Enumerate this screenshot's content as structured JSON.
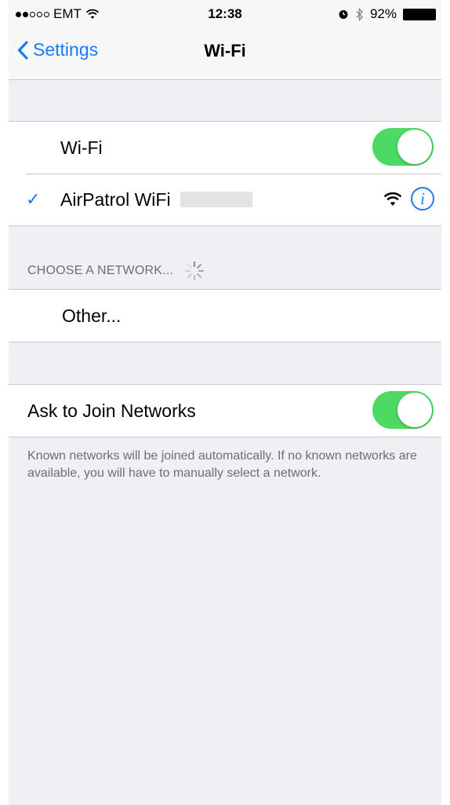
{
  "status_bar": {
    "carrier": "EMT",
    "time": "12:38",
    "battery_percent": "92%",
    "signal_strength": 2,
    "signal_total": 5
  },
  "nav": {
    "back_label": "Settings",
    "title": "Wi-Fi"
  },
  "wifi": {
    "toggle_label": "Wi-Fi",
    "enabled": true,
    "connected_network": "AirPatrol WiFi",
    "info_glyph": "i"
  },
  "choose_network": {
    "header": "CHOOSE A NETWORK...",
    "other_label": "Other..."
  },
  "ask_to_join": {
    "label": "Ask to Join Networks",
    "enabled": true,
    "footer": "Known networks will be joined automatically. If no known networks are available, you will have to manually select a network."
  },
  "colors": {
    "accent": "#1a7cf5",
    "toggle_on": "#4cd964",
    "background": "#efeff4"
  }
}
